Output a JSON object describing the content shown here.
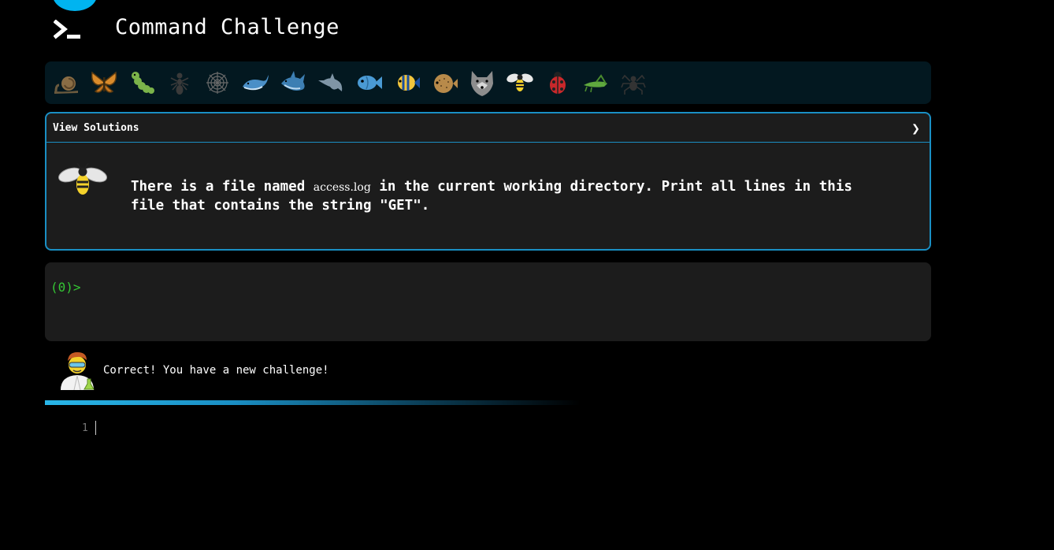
{
  "header": {
    "title": "Command Challenge",
    "logo_icon": "terminal-prompt-icon"
  },
  "critters": [
    {
      "name": "snail",
      "icon": "snail-icon"
    },
    {
      "name": "butterfly",
      "icon": "butterfly-icon"
    },
    {
      "name": "caterpillar",
      "icon": "caterpillar-icon"
    },
    {
      "name": "ant",
      "icon": "ant-icon"
    },
    {
      "name": "spider-web",
      "icon": "spider-web-icon"
    },
    {
      "name": "whale",
      "icon": "whale-icon"
    },
    {
      "name": "shark",
      "icon": "shark-icon"
    },
    {
      "name": "dolphin",
      "icon": "dolphin-icon"
    },
    {
      "name": "fish",
      "icon": "fish-icon"
    },
    {
      "name": "tropical-fish",
      "icon": "tropical-fish-icon"
    },
    {
      "name": "pufferfish",
      "icon": "pufferfish-icon"
    },
    {
      "name": "wolf",
      "icon": "wolf-icon"
    },
    {
      "name": "bee",
      "icon": "bee-icon"
    },
    {
      "name": "ladybug",
      "icon": "ladybug-icon"
    },
    {
      "name": "cricket",
      "icon": "cricket-icon"
    },
    {
      "name": "spider",
      "icon": "spider-icon"
    }
  ],
  "solutions_panel": {
    "toggle_label": "View Solutions",
    "chevron": "❯",
    "challenge_icon": "bee-icon",
    "task": {
      "before": "There is a file named ",
      "filename": "access.log",
      "after": " in the current working directory. Print all lines in this file that contains the string \"GET\"."
    }
  },
  "terminal": {
    "prompt": "(0)>"
  },
  "status": {
    "avatar_icon": "scientist-avatar-icon",
    "message": "Correct! You have a new challenge!"
  },
  "progress": {
    "fraction": 0.5
  },
  "editor": {
    "line_number": "1"
  },
  "colors": {
    "accent": "#1a8fc4",
    "prompt_green": "#34c634",
    "panel_bg": "#1c1c1c",
    "critter_bar_bg": "#031820"
  }
}
